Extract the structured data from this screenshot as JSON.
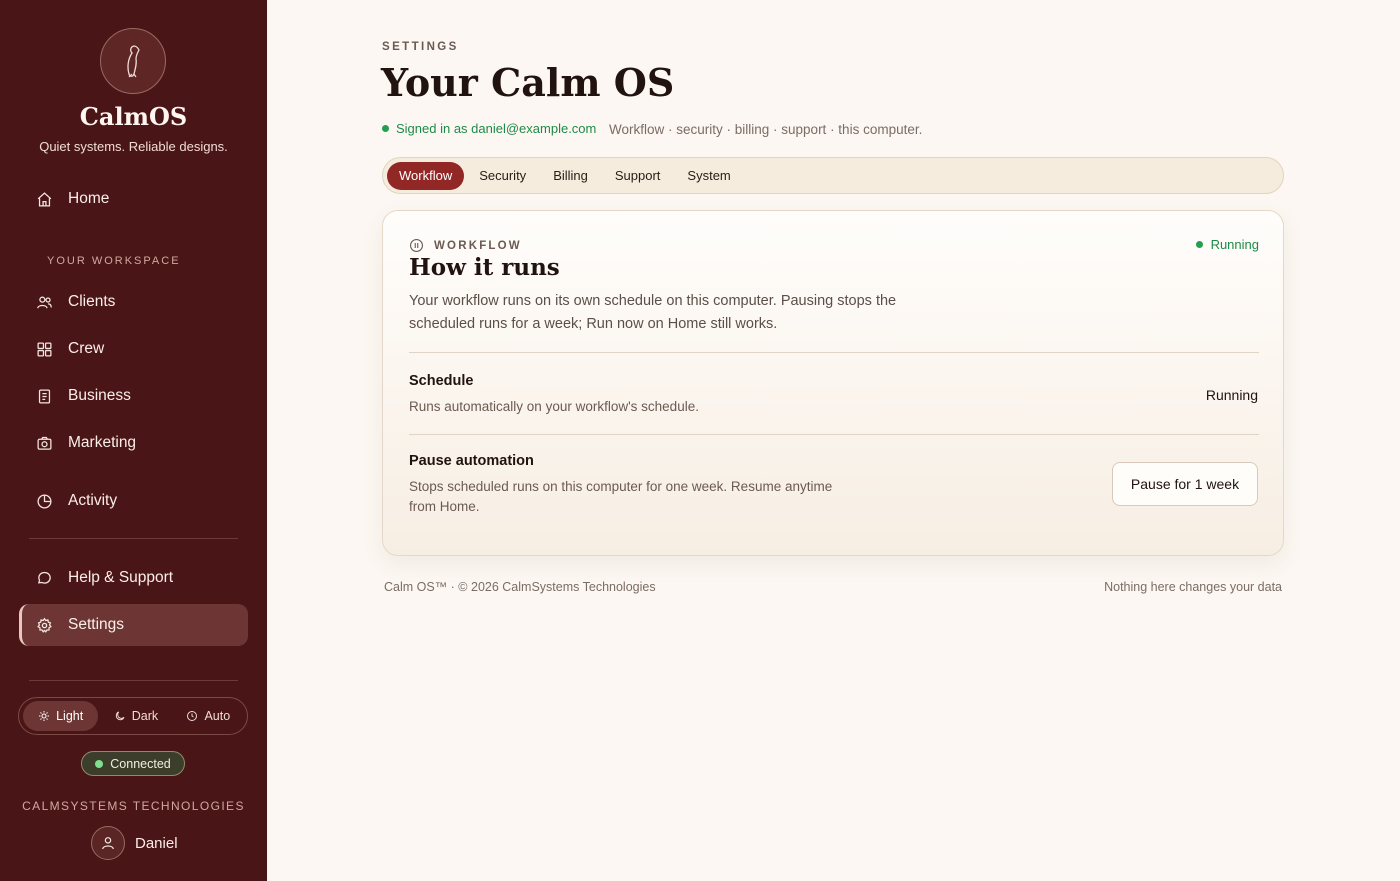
{
  "brand": {
    "name": "CalmOS",
    "tagline": "Quiet systems. Reliable designs."
  },
  "sidebar": {
    "home": "Home",
    "section_label": "YOUR WORKSPACE",
    "items": [
      {
        "label": "Clients",
        "icon": "users-icon"
      },
      {
        "label": "Crew",
        "icon": "grid-icon"
      },
      {
        "label": "Business",
        "icon": "document-icon"
      },
      {
        "label": "Marketing",
        "icon": "camera-icon"
      },
      {
        "label": "Activity",
        "icon": "pie-chart-icon"
      }
    ],
    "help": "Help & Support",
    "settings": "Settings",
    "theme": {
      "light": "Light",
      "dark": "Dark",
      "auto": "Auto",
      "selected": "Light"
    },
    "connection": "Connected",
    "company": "CALMSYSTEMS TECHNOLOGIES",
    "user": "Daniel"
  },
  "header": {
    "eyebrow": "SETTINGS",
    "title": "Your Calm OS",
    "signed_in": "Signed in as daniel@example.com",
    "subline": "Workflow · security · billing · support · this computer."
  },
  "tabs": [
    {
      "label": "Workflow",
      "active": true
    },
    {
      "label": "Security",
      "active": false
    },
    {
      "label": "Billing",
      "active": false
    },
    {
      "label": "Support",
      "active": false
    },
    {
      "label": "System",
      "active": false
    }
  ],
  "card": {
    "eyebrow": "WORKFLOW",
    "status": "Running",
    "title": "How it runs",
    "description": "Your workflow runs on its own schedule on this computer. Pausing stops the scheduled runs for a week; Run now on Home still works.",
    "schedule": {
      "title": "Schedule",
      "description": "Runs automatically on your workflow's schedule.",
      "value": "Running"
    },
    "pause": {
      "title": "Pause automation",
      "description": "Stops scheduled runs on this computer for one week. Resume anytime from Home.",
      "button": "Pause for 1 week"
    }
  },
  "footer": {
    "left": "Calm OS™ · © 2026 CalmSystems Technologies",
    "right": "Nothing here changes your data"
  },
  "colors": {
    "sidebar_bg": "#4a1516",
    "accent": "#922826",
    "status_green": "#22a04f",
    "page_bg": "#fcf7f2"
  }
}
